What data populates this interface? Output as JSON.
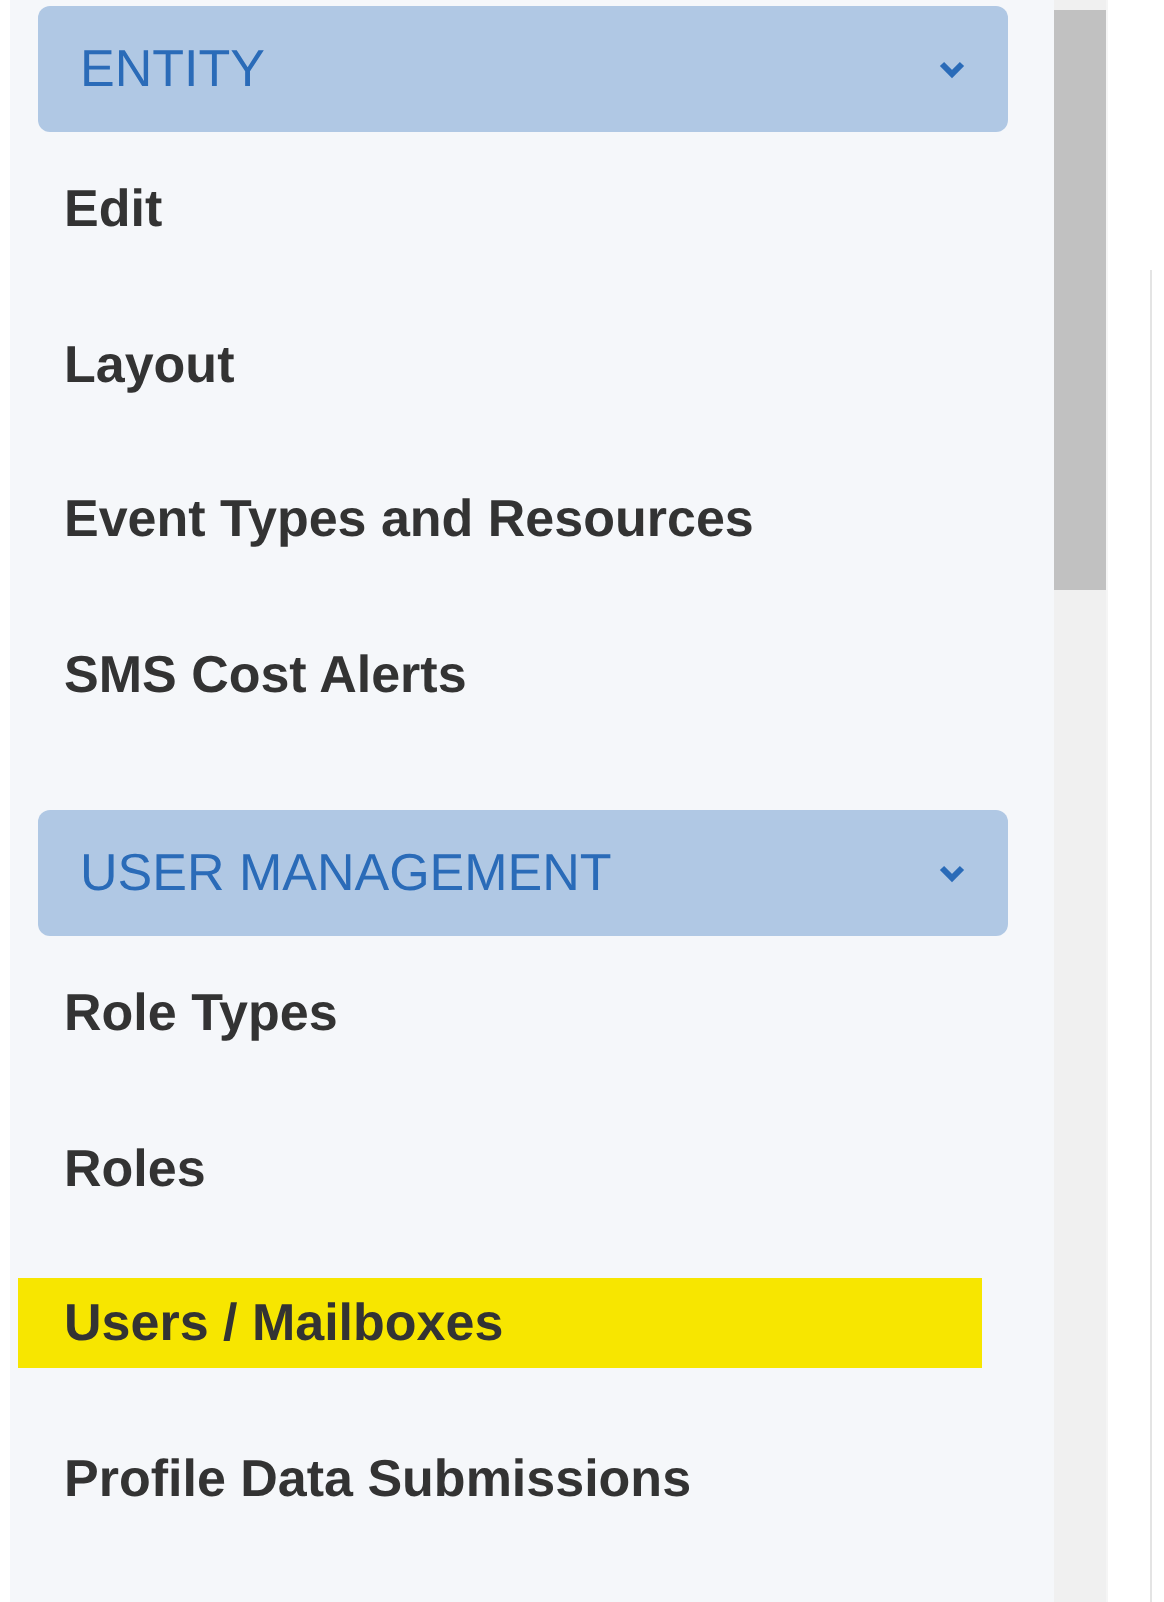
{
  "sections": [
    {
      "title": "ENTITY",
      "expanded": true,
      "items": [
        {
          "label": "Edit",
          "highlighted": false
        },
        {
          "label": "Layout",
          "highlighted": false
        },
        {
          "label": "Event Types and Resources",
          "highlighted": false
        },
        {
          "label": "SMS Cost Alerts",
          "highlighted": false
        }
      ]
    },
    {
      "title": "USER MANAGEMENT",
      "expanded": true,
      "items": [
        {
          "label": "Role Types",
          "highlighted": false
        },
        {
          "label": "Roles",
          "highlighted": false
        },
        {
          "label": "Users / Mailboxes",
          "highlighted": true
        },
        {
          "label": "Profile Data Submissions",
          "highlighted": false
        }
      ]
    }
  ]
}
